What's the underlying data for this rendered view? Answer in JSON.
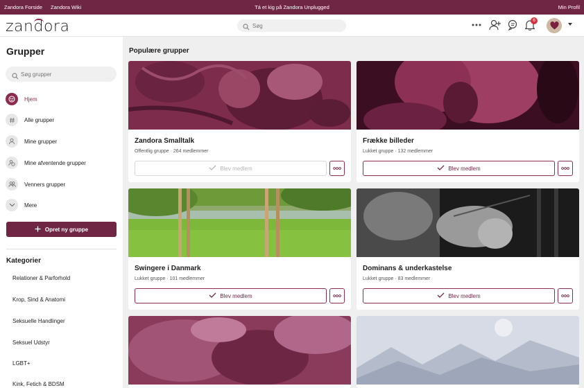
{
  "topbar": {
    "links": [
      "Zandora Forside",
      "Zandora Wiki"
    ],
    "promo": "Tá et kig på Zandora Unplugged",
    "profile": "Min Profil"
  },
  "header": {
    "logo": "zandora",
    "search_placeholder": "Søg",
    "notification_count": "6"
  },
  "sidebar": {
    "title": "Grupper",
    "search_placeholder": "Søg grupper",
    "nav": [
      {
        "label": "Hjem",
        "icon": "home-icon",
        "active": true
      },
      {
        "label": "Alle grupper",
        "icon": "hash-icon",
        "active": false
      },
      {
        "label": "Mine grupper",
        "icon": "user-icon",
        "active": false
      },
      {
        "label": "Mine afventende grupper",
        "icon": "pending-icon",
        "active": false
      },
      {
        "label": "Venners grupper",
        "icon": "friends-icon",
        "active": false
      },
      {
        "label": "Mere",
        "icon": "chevron-down-icon",
        "active": false
      }
    ],
    "create_label": "Opret ny gruppe",
    "categories_title": "Kategorier",
    "categories": [
      "Relationer & Parforhold",
      "Krop, Sind & Anatomi",
      "Seksuelle Handlinger",
      "Seksuel Udstyr",
      "LGBT+",
      "Kink, Fetich & BDSM"
    ]
  },
  "main": {
    "title": "Populære grupper",
    "join_label": "Blev medlem",
    "groups": [
      {
        "name": "Zandora Smalltalk",
        "meta": "Offentlig gruppe · 264 medlemmer",
        "joined": true
      },
      {
        "name": "Frække billeder",
        "meta": "Lukket gruppe · 132 medlemmer",
        "joined": false
      },
      {
        "name": "Swingere i Danmark",
        "meta": "Lukket gruppe · 101 medlemmer",
        "joined": false
      },
      {
        "name": "Dominans & underkastelse",
        "meta": "Lukket gruppe · 83 medlemmer",
        "joined": false
      }
    ]
  },
  "colors": {
    "brand": "#6e2644",
    "accent": "#8c2c4f",
    "badge": "#d8333c"
  }
}
